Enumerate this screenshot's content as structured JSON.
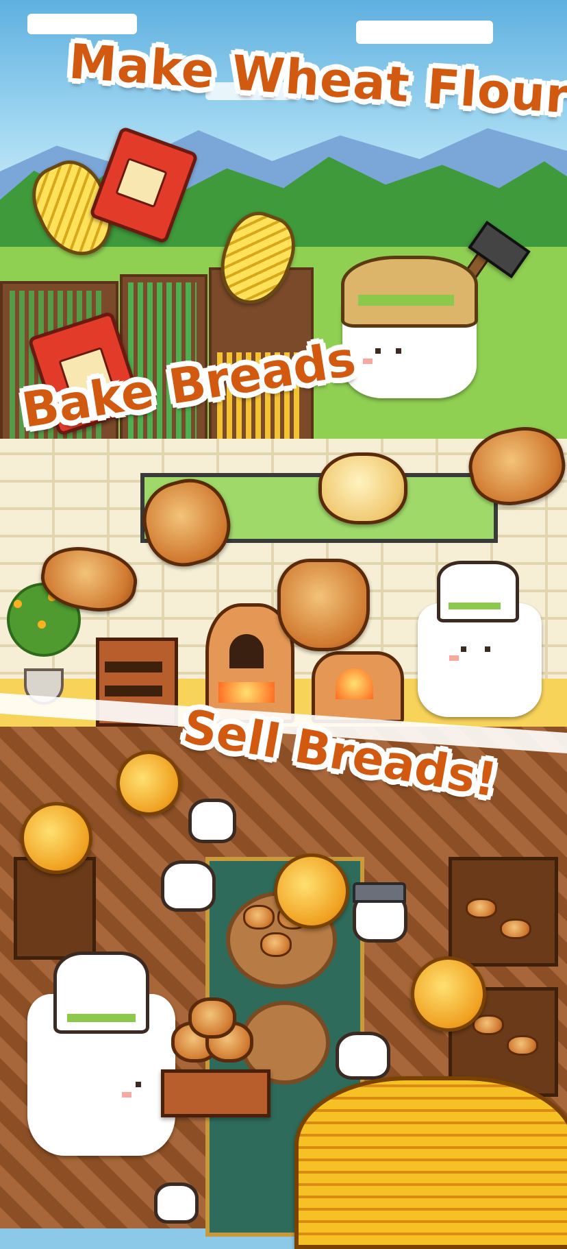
{
  "captions": {
    "make_flour": "Make Wheat Flour",
    "bake_breads": "Bake Breads",
    "sell_breads": "Sell Breads!"
  },
  "colors": {
    "caption_text": "#d15a10",
    "caption_outline": "#ffffff",
    "sky": "#5fb0e0",
    "field": "#8fcf52",
    "bakery_wall": "#f6efd6",
    "shop_floor": "#9b5a2c",
    "coin": "#f6c125"
  },
  "icons": {
    "wheat": "wheat-icon",
    "flour_bag": "flour-bag-icon",
    "bread": "bread-icon",
    "coin": "coin-icon",
    "pickaxe": "pickaxe-icon",
    "chef_hat": "chef-hat-icon"
  }
}
